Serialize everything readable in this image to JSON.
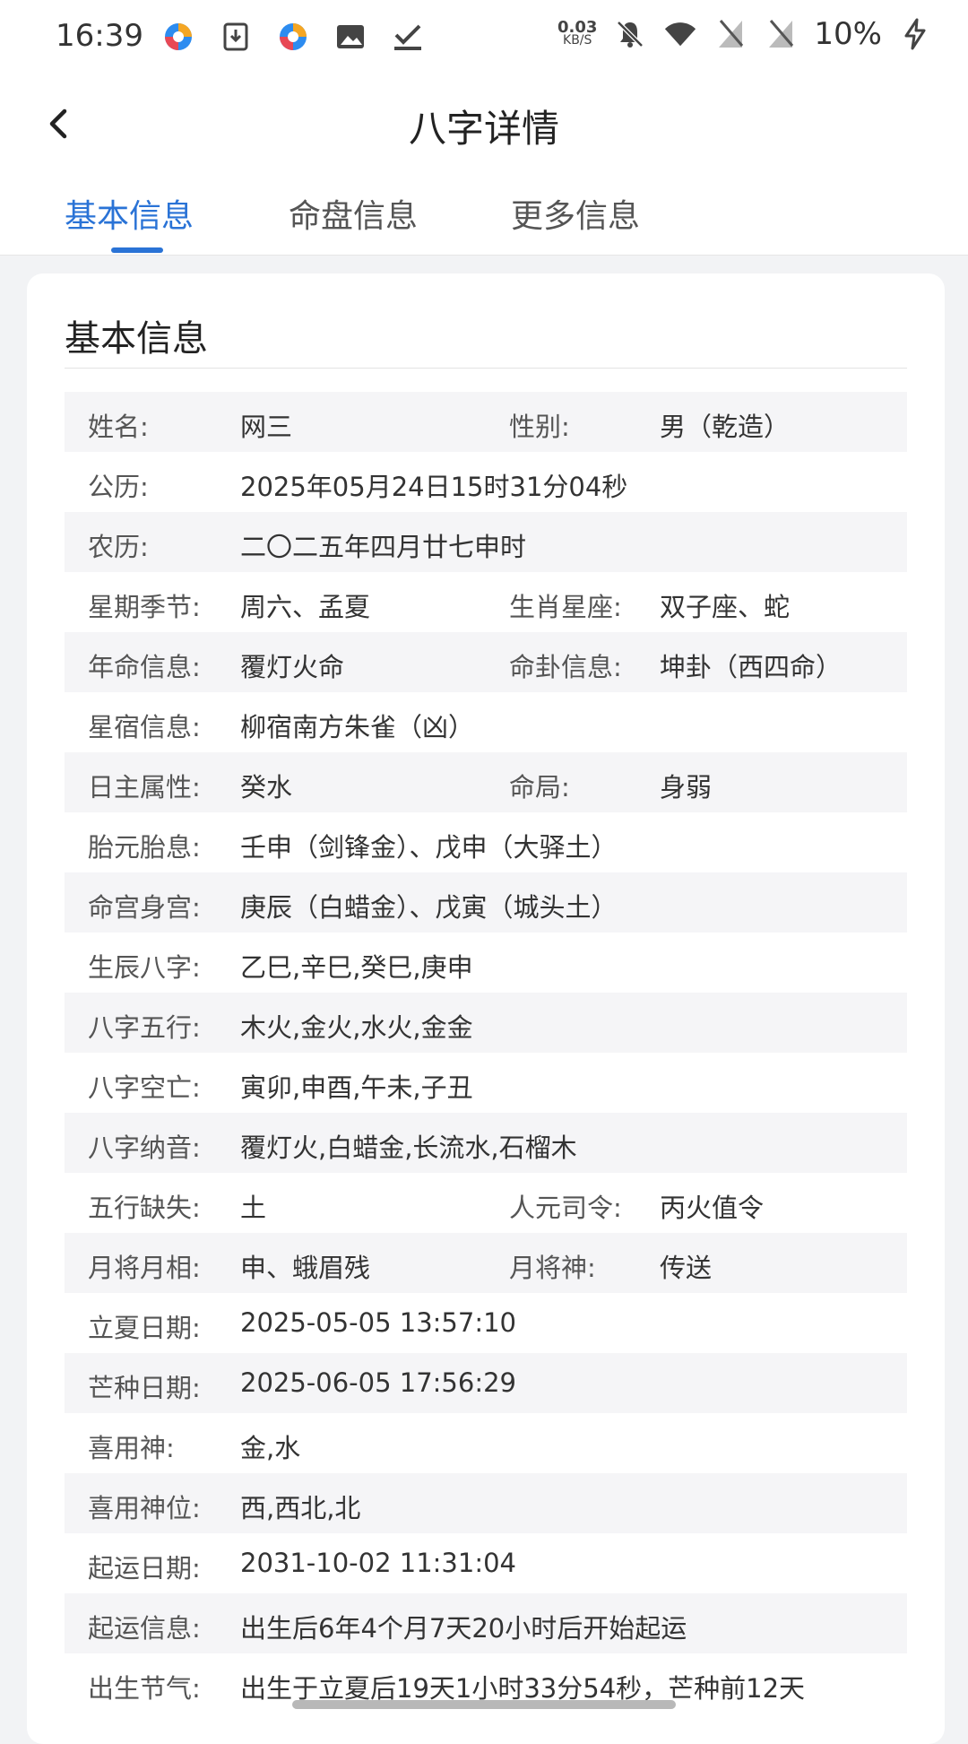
{
  "status_bar": {
    "time": "16:39",
    "left_icons": [
      "app-icon",
      "download-icon",
      "app-icon",
      "image-icon",
      "check-icon"
    ],
    "net_speed_value": "0.03",
    "net_speed_unit": "KB/S",
    "right_icons": [
      "mute-icon",
      "wifi-icon",
      "no-sim-icon",
      "no-sim-icon"
    ],
    "battery": "10%",
    "battery_icon": "charging-icon"
  },
  "header": {
    "title": "八字详情",
    "back_icon": "back-arrow-icon"
  },
  "tabs": [
    {
      "label": "基本信息",
      "active": true
    },
    {
      "label": "命盘信息",
      "active": false
    },
    {
      "label": "更多信息",
      "active": false
    }
  ],
  "colors": {
    "accent": "#2a73d6",
    "row_alt": "#f5f5f7",
    "page_bg": "#f2f3f5"
  },
  "card": {
    "title": "基本信息",
    "rows": [
      {
        "l1": "姓名:",
        "v1": "网三",
        "l2": "性别:",
        "v2": "男（乾造）"
      },
      {
        "l1": "公历:",
        "v1": "2025年05月24日15时31分04秒"
      },
      {
        "l1": "农历:",
        "v1": "二〇二五年四月廿七申时"
      },
      {
        "l1": "星期季节:",
        "v1": "周六、孟夏",
        "l2": "生肖星座:",
        "v2": "双子座、蛇"
      },
      {
        "l1": "年命信息:",
        "v1": "覆灯火命",
        "l2": "命卦信息:",
        "v2": "坤卦（西四命）"
      },
      {
        "l1": "星宿信息:",
        "v1": "柳宿南方朱雀（凶）"
      },
      {
        "l1": "日主属性:",
        "v1": "癸水",
        "l2": "命局:",
        "v2": "身弱"
      },
      {
        "l1": "胎元胎息:",
        "v1": "壬申（剑锋金）、戊申（大驿土）"
      },
      {
        "l1": "命宫身宫:",
        "v1": "庚辰（白蜡金）、戊寅（城头土）"
      },
      {
        "l1": "生辰八字:",
        "v1": "乙巳,辛巳,癸巳,庚申"
      },
      {
        "l1": "八字五行:",
        "v1": "木火,金火,水火,金金"
      },
      {
        "l1": "八字空亡:",
        "v1": "寅卯,申酉,午未,子丑"
      },
      {
        "l1": "八字纳音:",
        "v1": "覆灯火,白蜡金,长流水,石榴木"
      },
      {
        "l1": "五行缺失:",
        "v1": "土",
        "l2": "人元司令:",
        "v2": "丙火值令"
      },
      {
        "l1": "月将月相:",
        "v1": "申、蛾眉残",
        "l2": "月将神:",
        "v2": "传送"
      },
      {
        "l1": "立夏日期:",
        "v1": "2025-05-05 13:57:10"
      },
      {
        "l1": "芒种日期:",
        "v1": "2025-06-05 17:56:29"
      },
      {
        "l1": "喜用神:",
        "v1": "金,水"
      },
      {
        "l1": "喜用神位:",
        "v1": "西,西北,北"
      },
      {
        "l1": "起运日期:",
        "v1": "2031-10-02 11:31:04"
      },
      {
        "l1": "起运信息:",
        "v1": "出生后6年4个月7天20小时后开始起运"
      },
      {
        "l1": "出生节气:",
        "v1": "出生于立夏后19天1小时33分54秒，芒种前12天"
      }
    ]
  }
}
